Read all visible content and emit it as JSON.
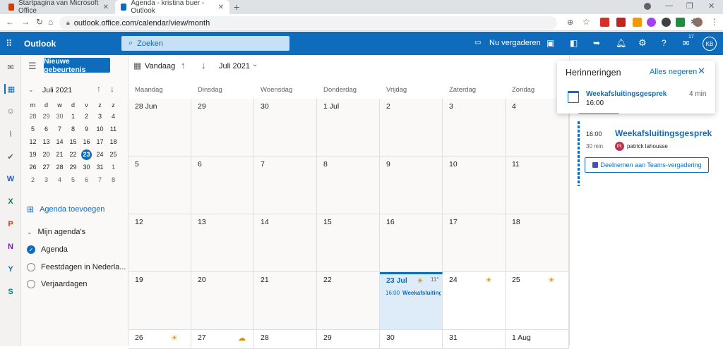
{
  "browser": {
    "tabs": [
      {
        "title": "Startpagina van Microsoft Office"
      },
      {
        "title": "Agenda - kristina buer - Outlook"
      }
    ],
    "url": "outlook.office.com/calendar/view/month"
  },
  "app": {
    "name": "Outlook",
    "search_placeholder": "Zoeken",
    "meet_now": "Nu vergaderen",
    "avatar": "KB",
    "notif_count": "17"
  },
  "toolbar": {
    "new_event": "Nieuwe gebeurtenis",
    "today": "Vandaag",
    "month_label": "Juli 2021"
  },
  "minical": {
    "title": "Juli 2021",
    "weekdays": [
      "m",
      "d",
      "w",
      "d",
      "v",
      "z",
      "z"
    ],
    "weeks": [
      [
        "28",
        "29",
        "30",
        "1",
        "2",
        "3",
        "4"
      ],
      [
        "5",
        "6",
        "7",
        "8",
        "9",
        "10",
        "11"
      ],
      [
        "12",
        "13",
        "14",
        "15",
        "16",
        "17",
        "18"
      ],
      [
        "19",
        "20",
        "21",
        "22",
        "23",
        "24",
        "25"
      ],
      [
        "26",
        "27",
        "28",
        "29",
        "30",
        "31",
        "1"
      ],
      [
        "2",
        "3",
        "4",
        "5",
        "6",
        "7",
        "8"
      ]
    ]
  },
  "sidebar": {
    "add_calendar": "Agenda toevoegen",
    "my_calendars": "Mijn agenda's",
    "calendars": [
      {
        "label": "Agenda",
        "checked": true
      },
      {
        "label": "Feestdagen in Nederla...",
        "checked": false
      },
      {
        "label": "Verjaardagen",
        "checked": false
      }
    ]
  },
  "grid": {
    "weekdays": [
      "Maandag",
      "Dinsdag",
      "Woensdag",
      "Donderdag",
      "Vrijdag",
      "Zaterdag",
      "Zondag"
    ],
    "weeks": [
      [
        "28 Jun",
        "29",
        "30",
        "1 Jul",
        "2",
        "3",
        "4"
      ],
      [
        "5",
        "6",
        "7",
        "8",
        "9",
        "10",
        "11"
      ],
      [
        "12",
        "13",
        "14",
        "15",
        "16",
        "17",
        "18"
      ],
      [
        "19",
        "20",
        "21",
        "22",
        "23 Jul",
        "24",
        "25"
      ],
      [
        "26",
        "27",
        "28",
        "29",
        "30",
        "31",
        "1 Aug"
      ]
    ],
    "today_temp": "11°",
    "today_event_time": "16:00",
    "today_event_title": "Weekafsluiting"
  },
  "reminders": {
    "title": "Herinneringen",
    "dismiss_all": "Alles negeren",
    "item_title": "Weekafsluitingsgesprek",
    "item_time": "16:00",
    "item_due": "4 min"
  },
  "event": {
    "time": "16:00",
    "duration": "30 min",
    "title": "Weekafsluitingsgesprek",
    "organizer_initials": "PL",
    "organizer": "patrick lahousse",
    "join": "Deelnemen aan Teams-vergadering"
  }
}
